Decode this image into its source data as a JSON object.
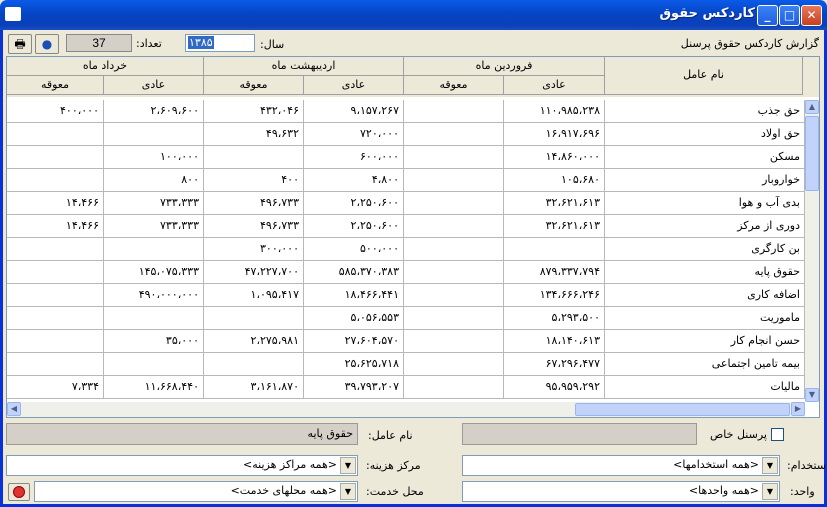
{
  "window": {
    "title": "کاردکس حقوق"
  },
  "toolbar": {
    "report_title": "گزارش کاردکس حقوق پرسنل",
    "year_label": "سال:",
    "year_value": "۱۳۸۵",
    "count_label": "تعداد:",
    "count_value": "37",
    "print_icon": "printer-icon",
    "globe_icon": "globe-icon"
  },
  "grid": {
    "name_header": "نام عامل",
    "months": [
      "فروردین ماه",
      "اردیبهشت ماه",
      "خرداد ماه"
    ],
    "sub_headers": {
      "normal": "عادی",
      "deferred": "معوقه"
    },
    "rows": [
      {
        "name": "حق جذب",
        "c1": "۱۱۰،۹۸۵،۲۳۸",
        "c2": "",
        "c3": "۹،۱۵۷،۲۶۷",
        "c4": "۴۳۲،۰۴۶",
        "c5": "۲،۶۰۹،۶۰۰",
        "c6": "۴۰۰،۰۰۰"
      },
      {
        "name": "حق اولاد",
        "c1": "۱۶،۹۱۷،۶۹۶",
        "c2": "",
        "c3": "۷۲۰،۰۰۰",
        "c4": "۴۹،۶۳۲",
        "c5": "",
        "c6": ""
      },
      {
        "name": "مسکن",
        "c1": "۱۴،۸۶۰،۰۰۰",
        "c2": "",
        "c3": "۶۰۰،۰۰۰",
        "c4": "",
        "c5": "۱۰۰،۰۰۰",
        "c6": ""
      },
      {
        "name": "خواروبار",
        "c1": "۱۰۵،۶۸۰",
        "c2": "",
        "c3": "۴،۸۰۰",
        "c4": "۴۰۰",
        "c5": "۸۰۰",
        "c6": ""
      },
      {
        "name": "بدی آب و هوا",
        "c1": "۳۲،۶۲۱،۶۱۳",
        "c2": "",
        "c3": "۲،۲۵۰،۶۰۰",
        "c4": "۴۹۶،۷۳۳",
        "c5": "۷۳۳،۳۳۳",
        "c6": "۱۴،۴۶۶"
      },
      {
        "name": "دوری از مرکز",
        "c1": "۳۲،۶۲۱،۶۱۳",
        "c2": "",
        "c3": "۲،۲۵۰،۶۰۰",
        "c4": "۴۹۶،۷۳۳",
        "c5": "۷۳۳،۳۳۳",
        "c6": "۱۴،۴۶۶"
      },
      {
        "name": "بن کارگری",
        "c1": "",
        "c2": "",
        "c3": "۵۰۰،۰۰۰",
        "c4": "۳۰۰،۰۰۰",
        "c5": "",
        "c6": ""
      },
      {
        "name": "حقوق پایه",
        "c1": "۸۷۹،۳۳۷،۷۹۴",
        "c2": "",
        "c3": "۵۸۵،۳۷۰،۳۸۳",
        "c4": "۴۷،۲۲۷،۷۰۰",
        "c5": "۱۴۵،۰۷۵،۳۳۳",
        "c6": ""
      },
      {
        "name": "اضافه کاری",
        "c1": "۱۳۴،۶۶۶،۲۴۶",
        "c2": "",
        "c3": "۱۸،۴۶۶،۴۴۱",
        "c4": "۱،۰۹۵،۴۱۷",
        "c5": "۴۹۰،۰۰۰،۰۰۰",
        "c6": ""
      },
      {
        "name": "ماموریت",
        "c1": "۵،۲۹۳،۵۰۰",
        "c2": "",
        "c3": "۵،۰۵۶،۵۵۳",
        "c4": "",
        "c5": "",
        "c6": ""
      },
      {
        "name": "حسن انجام کار",
        "c1": "۱۸،۱۴۰،۶۱۳",
        "c2": "",
        "c3": "۲۷،۶۰۴،۵۷۰",
        "c4": "۲،۲۷۵،۹۸۱",
        "c5": "۳۵،۰۰۰",
        "c6": ""
      },
      {
        "name": "بیمه تامین اجتماعی",
        "c1": "۶۷،۲۹۶،۴۷۷",
        "c2": "",
        "c3": "۲۵،۶۲۵،۷۱۸",
        "c4": "",
        "c5": "",
        "c6": ""
      },
      {
        "name": "مالیات",
        "c1": "۹۵،۹۵۹،۲۹۲",
        "c2": "",
        "c3": "۳۹،۷۹۳،۲۰۷",
        "c4": "۳،۱۶۱،۸۷۰",
        "c5": "۱۱،۶۶۸،۴۴۰",
        "c6": "۷،۳۳۴"
      }
    ]
  },
  "footer": {
    "factor_label": "نام عامل:",
    "factor_value": "حقوق پایه",
    "special_staff_label": "پرسنل خاص",
    "cost_center_label": "مرکز هزینه:",
    "cost_center_value": "<همه مراکز هزینه>",
    "employment_label": "استخدام:",
    "employment_value": "<همه استخدامها>",
    "service_place_label": "محل خدمت:",
    "service_place_value": "<همه محلهای خدمت>",
    "unit_label": "واحد:",
    "unit_value": "<همه واحدها>"
  }
}
